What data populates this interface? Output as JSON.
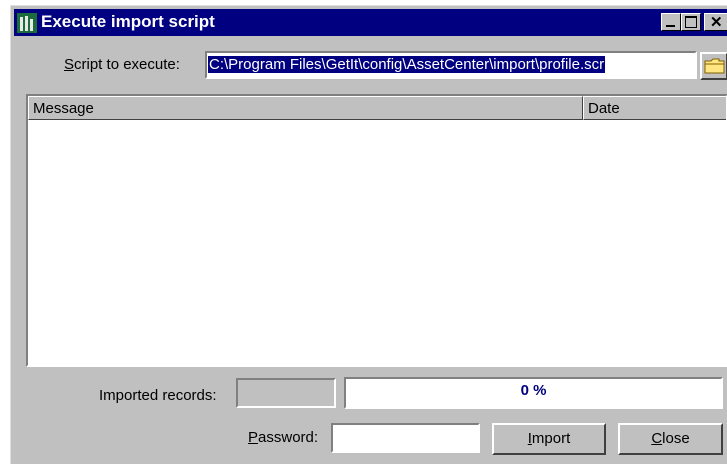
{
  "window": {
    "title": "Execute import script",
    "icon": "app-icon",
    "controls": [
      "minimize-icon",
      "maximize-icon",
      "close-icon"
    ]
  },
  "script_field": {
    "label_prefix": "",
    "label_access": "S",
    "label_rest": "cript to execute:",
    "value": "C:\\Program Files\\GetIt\\config\\AssetCenter\\import\\profile.scr",
    "browse_icon": "folder-icon"
  },
  "log_table": {
    "columns": [
      "Message",
      "Date"
    ],
    "rows": []
  },
  "progress": {
    "label": "Imported records:",
    "count": "",
    "percent_text": "0 %",
    "percent": 0
  },
  "password": {
    "label_access": "P",
    "label_rest": "assword:",
    "value": ""
  },
  "buttons": {
    "import_access": "I",
    "import_rest": "mport",
    "close_access": "C",
    "close_rest": "lose"
  },
  "colors": {
    "title_bar": "#000080",
    "face": "#c0c0c0",
    "progress_text": "#000080"
  }
}
